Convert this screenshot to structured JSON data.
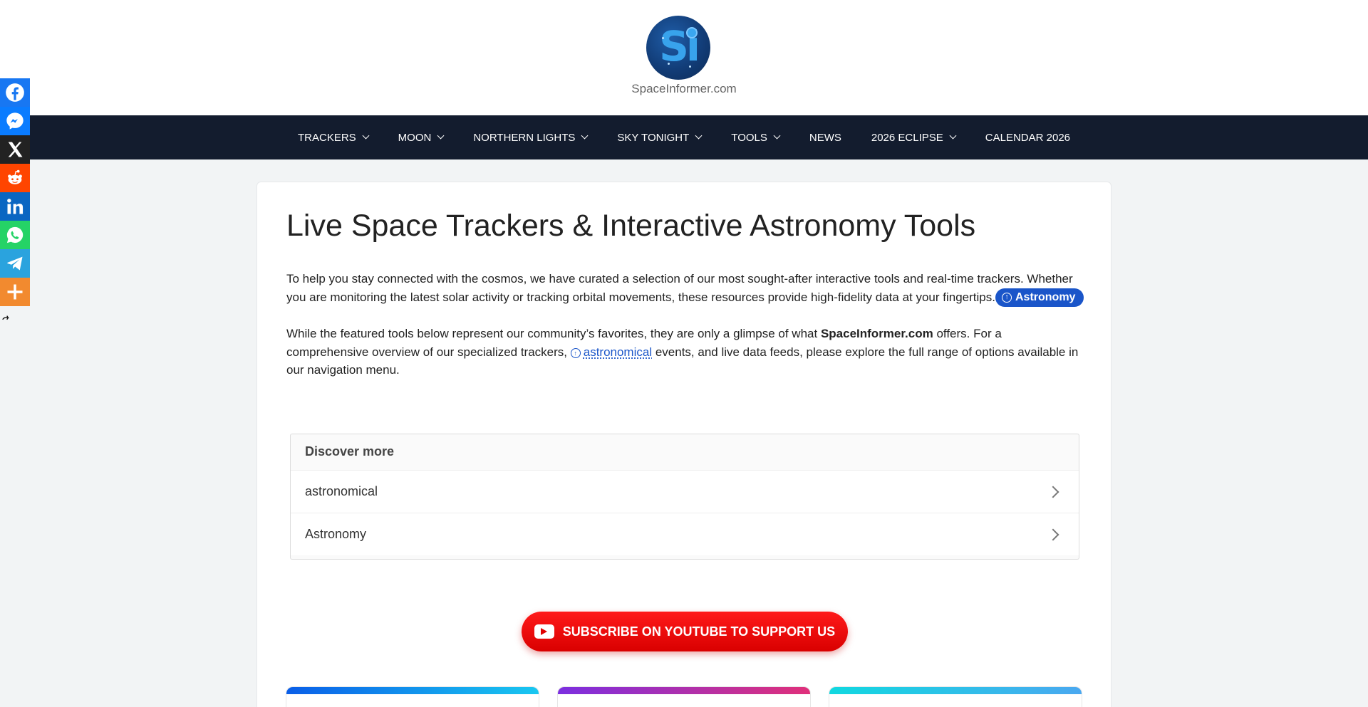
{
  "site": {
    "logo_text": "Si",
    "title": "SpaceInformer.com"
  },
  "nav": {
    "items": [
      {
        "label": "TRACKERS",
        "dropdown": true
      },
      {
        "label": "MOON",
        "dropdown": true
      },
      {
        "label": "NORTHERN LIGHTS",
        "dropdown": true
      },
      {
        "label": "SKY TONIGHT",
        "dropdown": true
      },
      {
        "label": "TOOLS",
        "dropdown": true
      },
      {
        "label": "NEWS",
        "dropdown": false
      },
      {
        "label": "2026 ECLIPSE",
        "dropdown": true
      },
      {
        "label": "CALENDAR 2026",
        "dropdown": false
      }
    ]
  },
  "social": [
    {
      "name": "facebook",
      "color": "#1877f2"
    },
    {
      "name": "messenger",
      "color": "#0a7cff"
    },
    {
      "name": "x",
      "color": "#222222"
    },
    {
      "name": "reddit",
      "color": "#ff4500"
    },
    {
      "name": "linkedin",
      "color": "#0a66c2"
    },
    {
      "name": "whatsapp",
      "color": "#25d366"
    },
    {
      "name": "telegram",
      "color": "#2aa3de"
    },
    {
      "name": "more",
      "color": "#f28a2f"
    }
  ],
  "article": {
    "title": "Live Space Trackers & Interactive Astronomy Tools",
    "para1": "To help you stay connected with the cosmos, we have curated a selection of our most sought-after interactive tools and real-time trackers. Whether you are monitoring the latest solar activity or tracking orbital movements, these resources provide high-fidelity data at your fingertips.",
    "para1_pill": "Astronomy",
    "para2_a": "While the featured tools below represent our community’s favorites, they are only a glimpse of what ",
    "para2_brand": "SpaceInformer.com",
    "para2_b": " offers. For a comprehensive overview of our specialized trackers, ",
    "para2_link": "astronomical",
    "para2_c": " events, and live data feeds, please explore the full range of options available in our navigation menu."
  },
  "discover": {
    "heading": "Discover more",
    "items": [
      "astronomical",
      "Astronomy"
    ]
  },
  "youtube": {
    "label": "SUBSCRIBE ON YOUTUBE TO SUPPORT US"
  },
  "colors": {
    "nav_bg": "#131c2e",
    "accent": "#1a55c9",
    "youtube_red": "#e00000"
  }
}
